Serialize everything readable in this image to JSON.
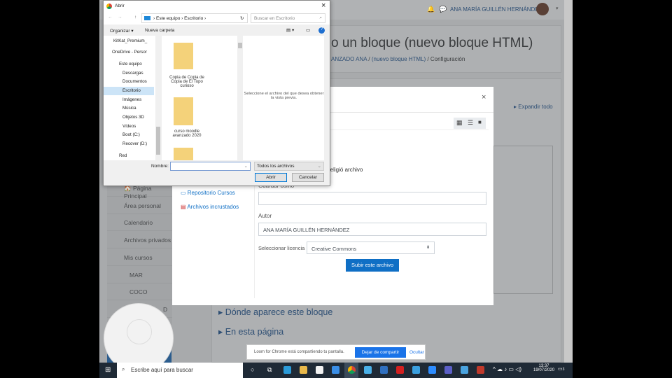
{
  "moodle": {
    "user_name": "ANA MARÍA GUILLÉN HERNÁNDEZ",
    "page_title": "o un bloque (nuevo bloque HTML)",
    "breadcrumb": [
      "ANZADO ANA",
      "(nuevo bloque HTML)",
      "Configuración"
    ],
    "breadcrumb_sep": "/",
    "expand_all": "Expandir todo",
    "sidebar": [
      "Página Principal",
      "Área personal",
      "Calendario",
      "Archivos privados",
      "Mis cursos",
      "MAR",
      "COCO",
      "D"
    ],
    "sections": [
      "Dónde aparece este bloque",
      "En esta página"
    ]
  },
  "picker": {
    "close": "×",
    "repos": [
      "Repositorio Cursos",
      "Archivos incrustados"
    ],
    "no_file": "e eligió archivo",
    "save_as_label": "Guardar como",
    "save_as_value": "",
    "author_label": "Autor",
    "author_value": "ANA MARÍA GUILLÉN HERNÁNDEZ",
    "license_label": "Seleccionar licencia",
    "license_value": "Creative Commons",
    "upload_button": "Subir este archivo"
  },
  "file_dialog": {
    "title": "Abrir",
    "path": [
      "Este equipo",
      "Escritorio"
    ],
    "search_placeholder": "Buscar en Escritorio",
    "organize": "Organizar ▾",
    "new_folder": "Nueva carpeta",
    "nav": [
      "KitKat_Premium_",
      "OneDrive - Persor",
      "Este equipo",
      "Descargas",
      "Documentos",
      "Escritorio",
      "Imágenes",
      "Música",
      "Objetos 3D",
      "Vídeos",
      "Boot (C:)",
      "Recover (D:)",
      "Red"
    ],
    "selected_nav": "Escritorio",
    "files": [
      "Copia de Copia de Copia de El Topo curioso",
      "curso moodle avanzado 2020"
    ],
    "preview_text": "Seleccione el archivo del que desea obtener la vista previa.",
    "name_label": "Nombre:",
    "name_value": "",
    "filter": "Todos los archivos",
    "open": "Abrir",
    "cancel": "Cancelar"
  },
  "loom": {
    "message": "Loom for Chrome está compartiendo tu pantalla.",
    "stop": "Dejar de compartir",
    "hide": "Ocultar"
  },
  "taskbar": {
    "search_placeholder": "Escribe aquí para buscar",
    "time": "13:37",
    "date": "19/07/2020",
    "notifications": "3"
  },
  "colors": {
    "accent": "#0f6fc5",
    "overlay": "#a8aaac",
    "taskbar": "#1f2a36"
  }
}
